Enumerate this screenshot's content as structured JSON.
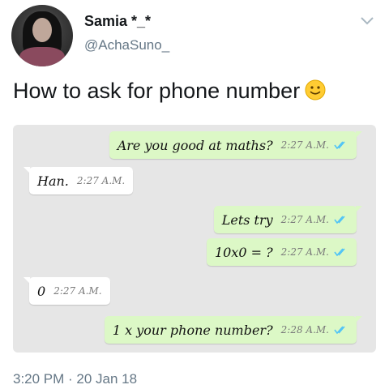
{
  "author": {
    "name": "Samia *_*",
    "handle": "@AchaSuno_"
  },
  "tweet": {
    "text": "How to ask for phone number",
    "emoji": "slightly-smiling-face"
  },
  "chat": {
    "messages": [
      {
        "side": "outgoing",
        "text": "Are you good at maths?",
        "time": "2:27 A.M.",
        "read": true
      },
      {
        "side": "incoming",
        "text": "Han.",
        "time": "2:27 A.M."
      },
      {
        "side": "outgoing",
        "text": "Lets try",
        "time": "2:27 A.M.",
        "read": true
      },
      {
        "side": "outgoing",
        "text": "10x0 = ?",
        "time": "2:27 A.M.",
        "read": true
      },
      {
        "side": "incoming",
        "text": "0",
        "time": "2:27 A.M."
      },
      {
        "side": "outgoing",
        "text": "1 x your phone number?",
        "time": "2:28 A.M.",
        "read": true
      }
    ]
  },
  "footer": {
    "timestamp": "3:20 PM · 20 Jan 18"
  },
  "colors": {
    "outgoing_bubble": "#dcf8c6",
    "incoming_bubble": "#ffffff",
    "read_ticks": "#4fc3f7",
    "card_background": "#e6e6e6"
  }
}
